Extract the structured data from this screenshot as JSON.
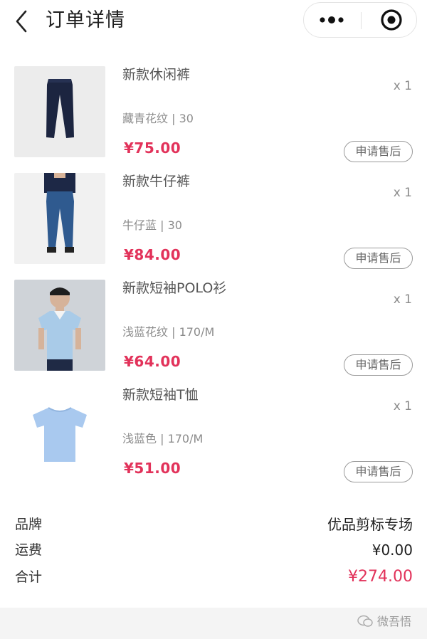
{
  "header": {
    "title": "订单详情",
    "back_icon": "chevron-left-icon",
    "menu_icon": "more-dots-icon",
    "close_icon": "target-circle-icon"
  },
  "items": [
    {
      "name": "新款休闲裤",
      "spec": "藏青花纹 | 30",
      "price": "¥75.00",
      "qty": "x 1",
      "action": "申请售后"
    },
    {
      "name": "新款牛仔裤",
      "spec": "牛仔蓝 | 30",
      "price": "¥84.00",
      "qty": "x 1",
      "action": "申请售后"
    },
    {
      "name": "新款短袖POLO衫",
      "spec": "浅蓝花纹 | 170/M",
      "price": "¥64.00",
      "qty": "x 1",
      "action": "申请售后"
    },
    {
      "name": "新款短袖T恤",
      "spec": "浅蓝色 | 170/M",
      "price": "¥51.00",
      "qty": "x 1",
      "action": "申请售后"
    }
  ],
  "summary": {
    "brand_label": "品牌",
    "brand_value": "优品剪标专场",
    "shipping_label": "运费",
    "shipping_value": "¥0.00",
    "total_label": "合计",
    "total_value": "¥274.00"
  },
  "watermark": {
    "text": "微吾悟"
  },
  "colors": {
    "accent": "#e2325a",
    "muted": "#8c8c8c",
    "border": "#9a9a9a"
  }
}
